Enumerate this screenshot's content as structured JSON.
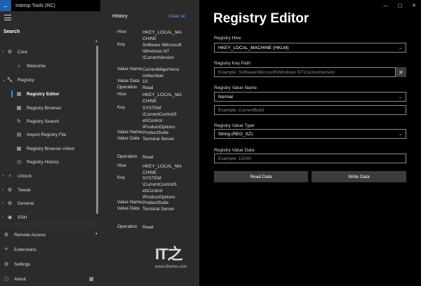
{
  "window": {
    "title": "Interop Tools (RC)",
    "back_icon": "back-arrow-icon",
    "controls": [
      "—",
      "▢",
      "✕"
    ]
  },
  "sidebar": {
    "search_label": "Search",
    "items": [
      {
        "label": "Core",
        "icon": "gear-icon",
        "expanded": false
      },
      {
        "label": "Welcome",
        "icon": "home-icon"
      },
      {
        "label": "Registry",
        "icon": "wrench-icon",
        "expanded": true
      },
      {
        "label": "Registry Editor",
        "icon": "editor-icon",
        "active": true
      },
      {
        "label": "Registry Browser",
        "icon": "grid-icon"
      },
      {
        "label": "Registry Search",
        "icon": "refresh-icon"
      },
      {
        "label": "Import Registry File",
        "icon": "document-icon"
      },
      {
        "label": "Registry Browser vNext",
        "icon": "grid-icon"
      },
      {
        "label": "Registry History",
        "icon": "history-icon"
      },
      {
        "label": "Unlock",
        "icon": "unlock-icon"
      },
      {
        "label": "Tweak",
        "icon": "gear-icon"
      },
      {
        "label": "General",
        "icon": "gear-icon"
      },
      {
        "label": "SSH",
        "icon": "globe-icon"
      }
    ],
    "bottom": [
      {
        "label": "Remote Access",
        "icon": "remote-icon"
      },
      {
        "label": "Extensions",
        "icon": "extensions-icon"
      },
      {
        "label": "Settings",
        "icon": "gear-icon"
      },
      {
        "label": "About",
        "icon": "info-icon"
      }
    ]
  },
  "history": {
    "title": "History",
    "clear_label": "Clear all",
    "entries": [
      {
        "k": "Hive",
        "v": "HKEY_LOCAL_MA CHINE"
      },
      {
        "k": "Key",
        "v": "Software \\Microsoft \\Windows NT \\CurrentVersion"
      },
      {
        "k": "Value Name",
        "v": "CurrentMajorVersi onNumber"
      },
      {
        "k": "Value Data",
        "v": "10"
      },
      {
        "k": "Operation",
        "v": "Read"
      },
      {
        "k": "Hive",
        "v": "HKEY_LOCAL_MA CHINE"
      },
      {
        "k": "Key",
        "v": "SYSTEM \\CurrentControlS et\\Control \\ProductOptions"
      },
      {
        "k": "Value Name",
        "v": "ProductSuite"
      },
      {
        "k": "Value Data",
        "v": "Terminal Server"
      },
      {
        "k": "Operation",
        "v": "Read"
      },
      {
        "k": "Hive",
        "v": "HKEY_LOCAL_MA CHINE"
      },
      {
        "k": "Key",
        "v": "SYSTEM \\CurrentControlS et\\Control \\ProductOptions"
      },
      {
        "k": "Value Name",
        "v": "ProductSuite"
      },
      {
        "k": "Value Data",
        "v": "Terminal Server"
      },
      {
        "k": "Operation",
        "v": "Read"
      }
    ]
  },
  "watermark": {
    "logo": "IT之",
    "site": "www.ithome.com"
  },
  "main": {
    "title": "Registry Editor",
    "hive_label": "Registry Hive",
    "hive_value": "HKEY_LOCAL_MACHINE (HKLM)",
    "key_path_label": "Registry Key Path",
    "key_path_placeholder": "Example: Software\\Microsoft\\Windows NT\\CurrentVersion",
    "value_name_label": "Registry Value Name",
    "value_name_mode": "Normal",
    "value_name_placeholder": "Example: CurrentBuild",
    "value_type_label": "Registry Value Type",
    "value_type_value": "String (REG_SZ)",
    "value_data_label": "Registry Value Data",
    "value_data_placeholder": "Example: 10240",
    "read_button": "Read Data",
    "write_button": "Write Data"
  }
}
